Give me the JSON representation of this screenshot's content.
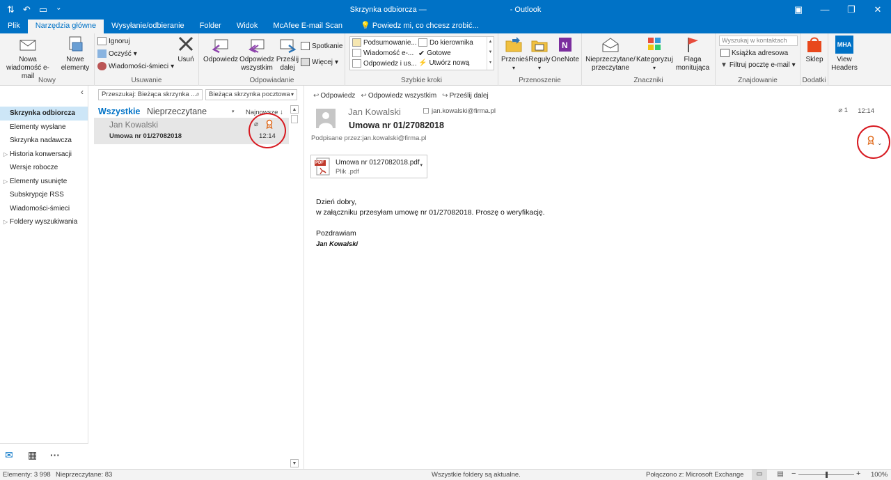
{
  "window": {
    "title": "Skrzynka odbiorcza —",
    "app": "- Outlook",
    "minimize": "—",
    "restore": "❐",
    "close": "✕"
  },
  "tabs": [
    {
      "label": "Plik"
    },
    {
      "label": "Narzędzia główne"
    },
    {
      "label": "Wysyłanie/odbieranie"
    },
    {
      "label": "Folder"
    },
    {
      "label": "Widok"
    },
    {
      "label": "McAfee E-mail Scan"
    },
    {
      "label": "Powiedz mi, co chcesz zrobić..."
    }
  ],
  "ribbon": {
    "new": {
      "new_email": "Nowa wiadomość e-mail",
      "new_items": "Nowe elementy",
      "label": "Nowy"
    },
    "delete": {
      "ignore": "Ignoruj",
      "clean": "Oczyść",
      "junk": "Wiadomości-śmieci",
      "delete": "Usuń",
      "label": "Usuwanie"
    },
    "respond": {
      "reply": "Odpowiedz",
      "reply_all": "Odpowiedz wszystkim",
      "forward": "Prześlij dalej",
      "meeting": "Spotkanie",
      "more": "Więcej",
      "label": "Odpowiadanie"
    },
    "quick_steps": {
      "items": [
        "Podsumowanie...",
        "Wiadomość e-...",
        "Odpowiedz i us...",
        "Do kierownika",
        "Gotowe",
        "Utwórz nową"
      ],
      "label": "Szybkie kroki"
    },
    "move": {
      "move": "Przenieś",
      "rules": "Reguły",
      "onenote": "OneNote",
      "label": "Przenoszenie"
    },
    "tags": {
      "unread_read": "Nieprzeczytane/ przeczytane",
      "categorize": "Kategoryzuj",
      "follow_up": "Flaga monitująca",
      "label": "Znaczniki"
    },
    "find": {
      "search_placeholder": "Wyszukaj w kontaktach",
      "address_book": "Książka adresowa",
      "filter_email": "Filtruj pocztę e-mail",
      "label": "Znajdowanie"
    },
    "addins": {
      "store": "Sklep",
      "label": "Dodatki"
    },
    "mha": {
      "icon_text": "MHA",
      "label": "View Headers"
    }
  },
  "nav": {
    "folders": [
      {
        "label": "Skrzynka odbiorcza"
      },
      {
        "label": "Elementy wysłane"
      },
      {
        "label": "Skrzynka nadawcza"
      },
      {
        "label": "Historia konwersacji"
      },
      {
        "label": "Wersje robocze"
      },
      {
        "label": "Elementy usunięte"
      },
      {
        "label": "Subskrypcje RSS"
      },
      {
        "label": "Wiadomości-śmieci"
      },
      {
        "label": "Foldery wyszukiwania"
      }
    ]
  },
  "list": {
    "search_placeholder": "Przeszukaj: Bieżąca skrzynka ...",
    "scope": "Bieżąca skrzynka pocztowa",
    "filter_all": "Wszystkie",
    "filter_unread": "Nieprzeczytane",
    "sort": "Najnowsze",
    "messages": [
      {
        "from": "Jan Kowalski",
        "subject": "Umowa nr 01/27082018",
        "time": "12:14"
      }
    ]
  },
  "reading": {
    "reply": "Odpowiedz",
    "reply_all": "Odpowiedz wszystkim",
    "forward": "Prześlij dalej",
    "sender": "Jan Kowalski",
    "sender_email": "jan.kowalski@firma.pl",
    "subject": "Umowa nr 01/27082018",
    "signed_by": "Podpisane przez:jan.kowalski@firma.pl",
    "time": "12:14",
    "attachment_count": "1",
    "attachment": {
      "name": "Umowa nr 0127082018.pdf",
      "type": "Plik .pdf",
      "icon_text": "PDF"
    },
    "body": {
      "line1": "Dzień dobry,",
      "line2": "w załączniku przesyłam umowę nr 01/27082018. Proszę o weryfikację.",
      "line3": "Pozdrawiam",
      "signature": "Jan Kowalski"
    }
  },
  "status": {
    "items": "Elementy: 3 998",
    "unread": "Nieprzeczytane: 83",
    "folders": "Wszystkie foldery są aktualne.",
    "connection": "Połączono z: Microsoft Exchange",
    "zoom": "100%"
  },
  "colors": {
    "accent": "#0072c6",
    "highlight": "#d71920"
  }
}
